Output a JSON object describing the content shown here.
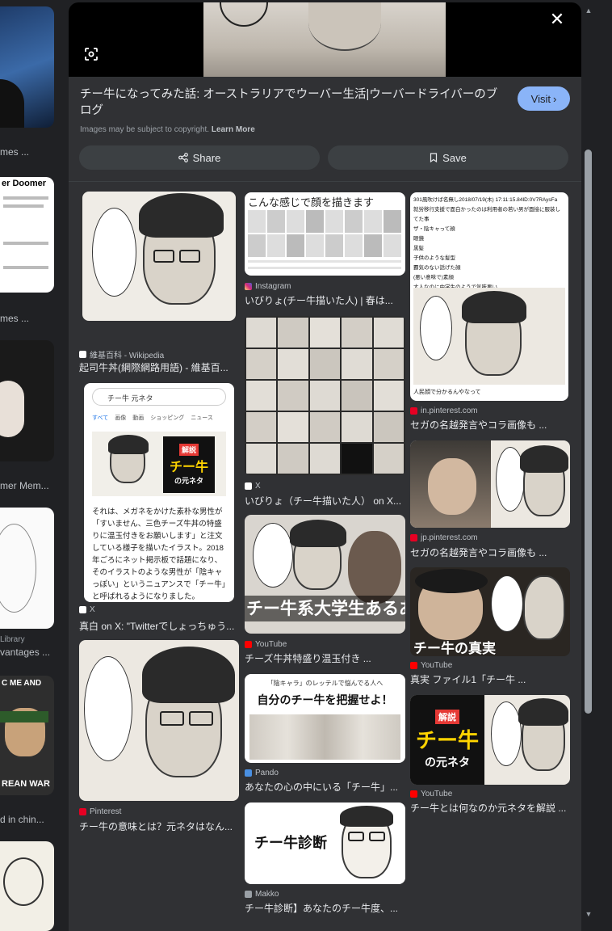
{
  "left_strip": {
    "captions": [
      "mes ...",
      "mes ...",
      "mer Mem...",
      "Library",
      "vantages ...",
      "d in chin..."
    ],
    "doomer_label": "er Doomer",
    "war_label": "REAN WAR",
    "me_label": "C ME AND"
  },
  "panel": {
    "title": "チー牛になってみた話: オーストラリアでウーバー生活|ウーバードライバーのブログ",
    "visit_label": "Visit",
    "copyright_text": "Images may be subject to copyright.",
    "learn_more": "Learn More",
    "share_label": "Share",
    "save_label": "Save"
  },
  "results": [
    {
      "source": "維基百科 - Wikipedia",
      "caption": "起司牛丼(網際網路用語) - 維基百...",
      "color": "#ffffff"
    },
    {
      "source": "X",
      "caption": "真白 on X: \"Twitterでしょっちゅう...",
      "color": "#ffffff"
    },
    {
      "source": "Pinterest",
      "caption": "チー牛の意味とは？元ネタはなん...",
      "color": "#e60023"
    },
    {
      "source": "Instagram",
      "caption": "いびりょ(チー牛描いた人) | 春は...",
      "color": "#d6249f"
    },
    {
      "source": "X",
      "caption": "いびりょ（チー牛描いた人） on X...",
      "color": "#ffffff"
    },
    {
      "source": "YouTube",
      "caption": "チーズ牛丼特盛り温玉付き ...",
      "color": "#ff0000"
    },
    {
      "source": "Pando",
      "caption": "あなたの心の中にいる「チー牛」...",
      "color": "#4a90e2"
    },
    {
      "source": "Makko",
      "caption": "チー牛診断】あなたのチー牛度、...",
      "color": "#9aa0a6"
    },
    {
      "source": "in.pinterest.com",
      "caption": "セガの名越発言やコラ画像も ...",
      "color": "#e60023"
    },
    {
      "source": "jp.pinterest.com",
      "caption": "セガの名越発言やコラ画像も ...",
      "color": "#e60023"
    },
    {
      "source": "YouTube",
      "caption": "真実 ファイル1「チー牛 ...",
      "color": "#ff0000"
    },
    {
      "source": "YouTube",
      "caption": "チー牛とは何なのか元ネタを解説 ...",
      "color": "#ff0000"
    }
  ],
  "tile_text": {
    "search_query": "チー牛 元ネタ",
    "search_tabs": [
      "すべて",
      "画像",
      "動画",
      "ショッピング",
      "ニュース"
    ],
    "kaisetsu": "解説",
    "chigyu": "チー牛",
    "motoneta": "の元ネタ",
    "article": "それは、メガネをかけた素朴な男性が「すいません、三色チーズ牛丼の特盛りに温玉付きをお願いします」と注文している様子を描いたイラスト。2018年ごろにネット掲示板で話題になり、そのイラストのような男性が「陰キャっぽい」というニュアンスで「チー牛」と呼ばれるようになりました。",
    "drawing_header": "こんな感じで顔を描きます",
    "daigakusei": "チー牛系大学生あるある",
    "pando_top": "「陰キャラ」のレッテルで悩んでる人へ",
    "pando_main": "自分のチー牛を把握せよ！",
    "shindan": "チー牛診断",
    "shinjitsu": "チー牛の真実",
    "list_text": "301風吹けば名無し2018/07/19(木) 17:11:15.84ID:0V7RAysFa\n就労移行支援で面白かったのは利用者の若い男が面接に服装してた事\nザ・陰キャって顔\n眼鏡\n黒髪\n子供のような髪型\n覇気のない話げた顔\n(悪い意味で)素顔\n大人なのに中学生のようで気味悪い\n10人いたら8人がそんな顔",
    "list_footer": "人民顔で分かるんやなって"
  }
}
